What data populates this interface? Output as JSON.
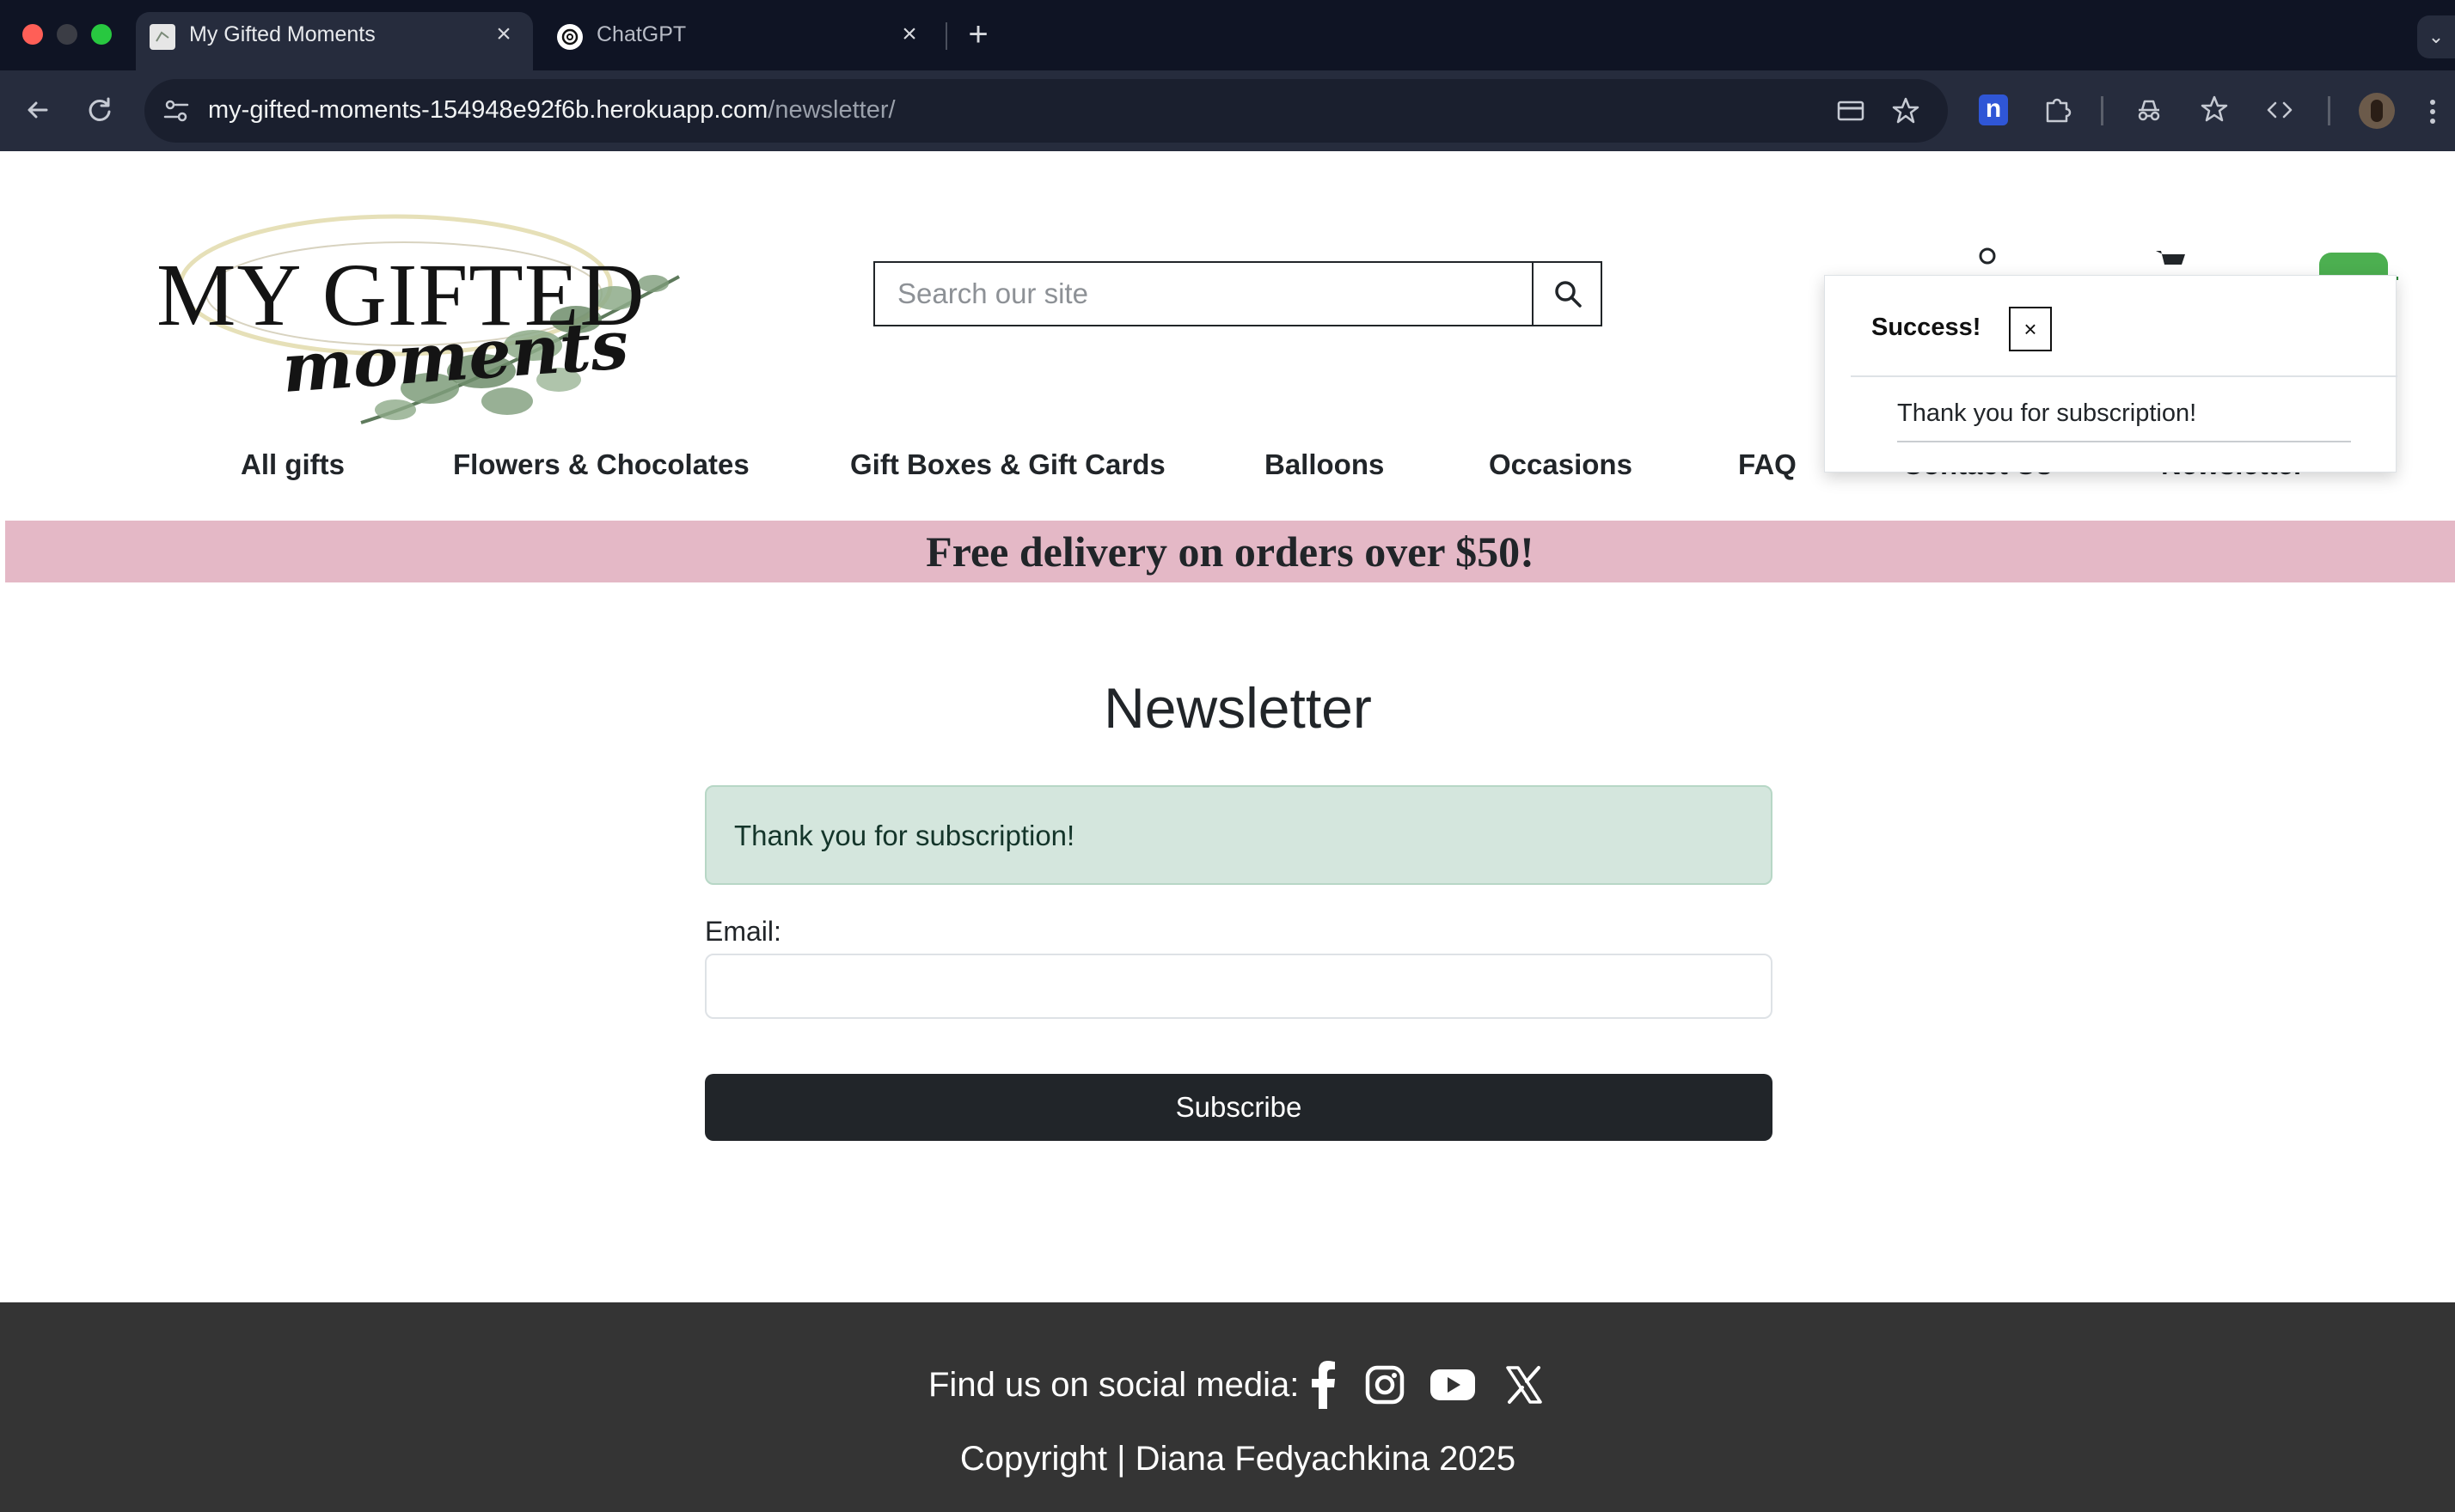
{
  "browser": {
    "tabs": [
      {
        "title": "My Gifted Moments",
        "active": true
      },
      {
        "title": "ChatGPT",
        "active": false
      }
    ],
    "url_host": "my-gifted-moments-154948e92f6b.herokuapp.com",
    "url_path": "/newsletter/",
    "extension_label": "n",
    "icons": [
      "back-icon",
      "reload-icon",
      "site-info-icon",
      "card-icon",
      "bookmark-star-icon",
      "extensions-puzzle-icon",
      "incognito-icon",
      "star-check-icon",
      "code-icon",
      "kebab-menu-icon"
    ]
  },
  "header": {
    "logo_line1": "MY GIFTED",
    "logo_line2": "moments",
    "search_placeholder": "Search our site"
  },
  "nav": {
    "items": [
      "All gifts",
      "Flowers & Chocolates",
      "Gift Boxes & Gift Cards",
      "Balloons",
      "Occasions",
      "FAQ",
      "Contact Us",
      "Newsletter"
    ]
  },
  "promo": {
    "text": "Free delivery on orders over $50!",
    "background": "#e4b8c6"
  },
  "toast": {
    "title": "Success!",
    "close": "×",
    "message": "Thank you for subscription!"
  },
  "main": {
    "heading": "Newsletter",
    "alert": "Thank you for subscription!",
    "email_label": "Email:",
    "email_value": "",
    "subscribe": "Subscribe"
  },
  "footer": {
    "social_label": "Find us on social media:",
    "social_icons": [
      "facebook-icon",
      "instagram-icon",
      "youtube-icon",
      "x-icon"
    ],
    "copyright": "Copyright | Diana Fedyachkina 2025"
  },
  "colors": {
    "accent_green": "#2e8b3a",
    "button_dark": "#212529",
    "footer_bg": "#343434",
    "alert_bg": "#d4e6dd"
  }
}
